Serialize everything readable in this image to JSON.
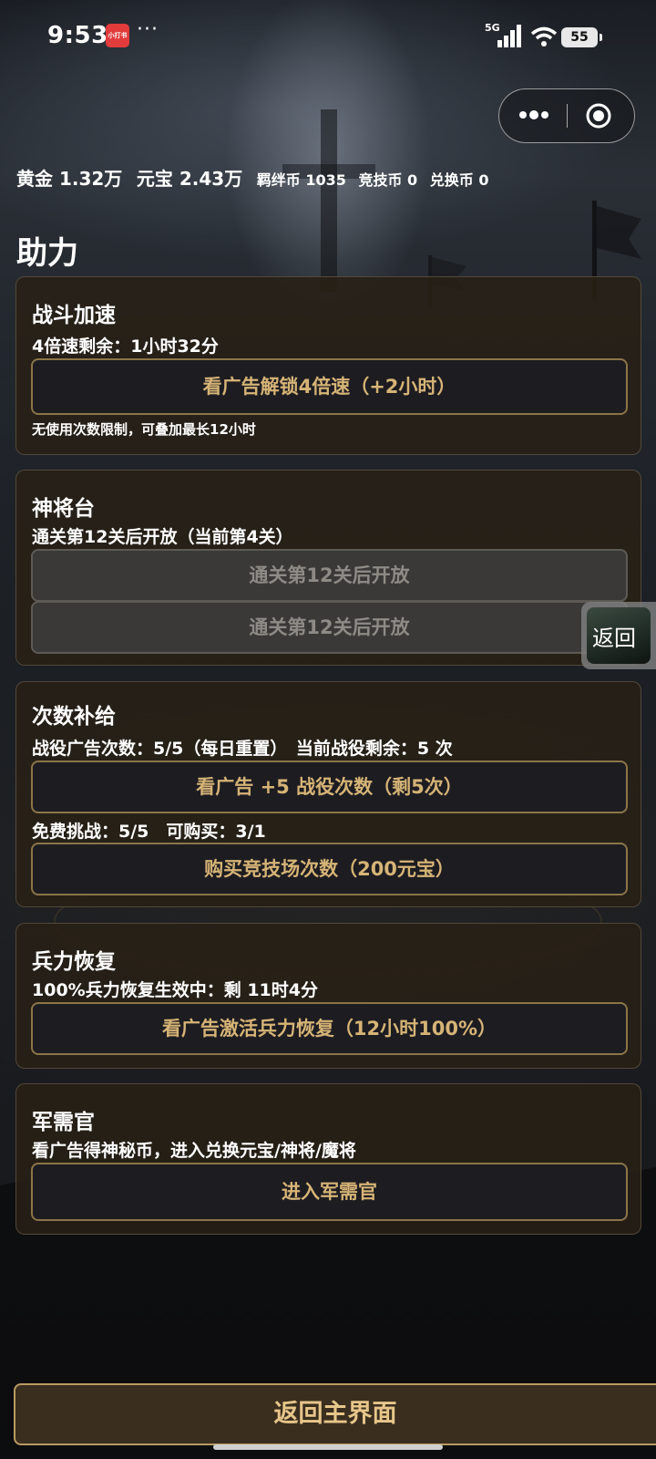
{
  "status_bar": {
    "time": "9:53",
    "app_badge": "小打书",
    "more": "···",
    "network": "5G",
    "battery": "55"
  },
  "capsule": {
    "more_icon": "more-dots-icon",
    "close_icon": "target-circle-icon"
  },
  "resources": {
    "gold": "黄金 1.32万",
    "yuanbao": "元宝 2.43万",
    "bond_coin": "羁绊币 1035",
    "arena_coin": "竞技币 0",
    "exchange_coin": "兑换币 0"
  },
  "page_title": "助力",
  "cards": {
    "speedup": {
      "title": "战斗加速",
      "status": "4倍速剩余：1小时32分",
      "button": "看广告解锁4倍速（+2小时）",
      "note": "无使用次数限制，可叠加最长12小时"
    },
    "shenjiang": {
      "title": "神将台",
      "status": "通关第12关后开放（当前第4关）",
      "button1": "通关第12关后开放",
      "button2": "通关第12关后开放"
    },
    "refill": {
      "title": "次数补给",
      "status": "战役广告次数：5/5（每日重置）　当前战役剩余：5 次",
      "button1": "看广告 +5 战役次数（剩5次）",
      "status2": "免费挑战：5/5　可购买：3/1",
      "button2": "购买竞技场次数（200元宝）"
    },
    "troops": {
      "title": "兵力恢复",
      "status": "100%兵力恢复生效中：剩 11时4分",
      "button": "看广告激活兵力恢复（12小时100%）"
    },
    "quartermaster": {
      "title": "军需官",
      "status": "看广告得神秘币，进入兑换元宝/神将/魔将",
      "button": "进入军需官"
    }
  },
  "float_back": "返回",
  "bottom_button": "返回主界面",
  "colors": {
    "card_bg": "#282016",
    "button_border": "#8b7548",
    "button_text": "#d6b476",
    "disabled_text": "#8e8b86",
    "bottom_button_text": "#e7c68a"
  }
}
